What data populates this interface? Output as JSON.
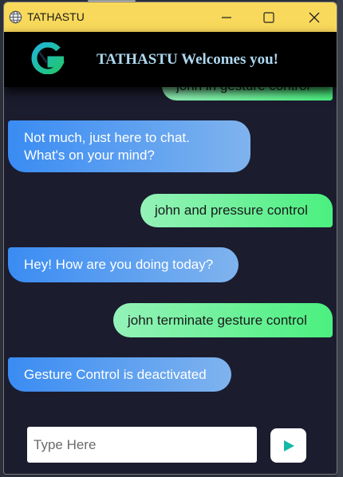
{
  "window": {
    "title": "TATHASTU",
    "controls": {
      "minimize": "minimize-icon",
      "maximize": "maximize-icon",
      "close": "close-icon"
    }
  },
  "header": {
    "logo": "g-logo-icon",
    "title": "TATHASTU Welcomes you!"
  },
  "messages": [
    {
      "sender": "user",
      "text": "john in gesture control"
    },
    {
      "sender": "bot",
      "text": "Not much, just here to chat. What's on your mind?"
    },
    {
      "sender": "user",
      "text": "john and pressure control"
    },
    {
      "sender": "bot",
      "text": "Hey! How are you doing today?"
    },
    {
      "sender": "user",
      "text": "john terminate gesture control"
    },
    {
      "sender": "bot",
      "text": "Gesture Control is deactivated"
    }
  ],
  "composer": {
    "placeholder": "Type Here",
    "value": "",
    "send_icon": "send-icon"
  },
  "colors": {
    "titlebar": "#f9d95b",
    "header_bg": "#000000",
    "header_text": "#aed8f0",
    "chat_bg": "#1b1c2e",
    "user_bubble_start": "#94f2b8",
    "user_bubble_end": "#4bf07f",
    "bot_bubble_start": "#3a8cf3",
    "bot_bubble_end": "#7fb3ee",
    "send_icon": "#14b8a6"
  }
}
